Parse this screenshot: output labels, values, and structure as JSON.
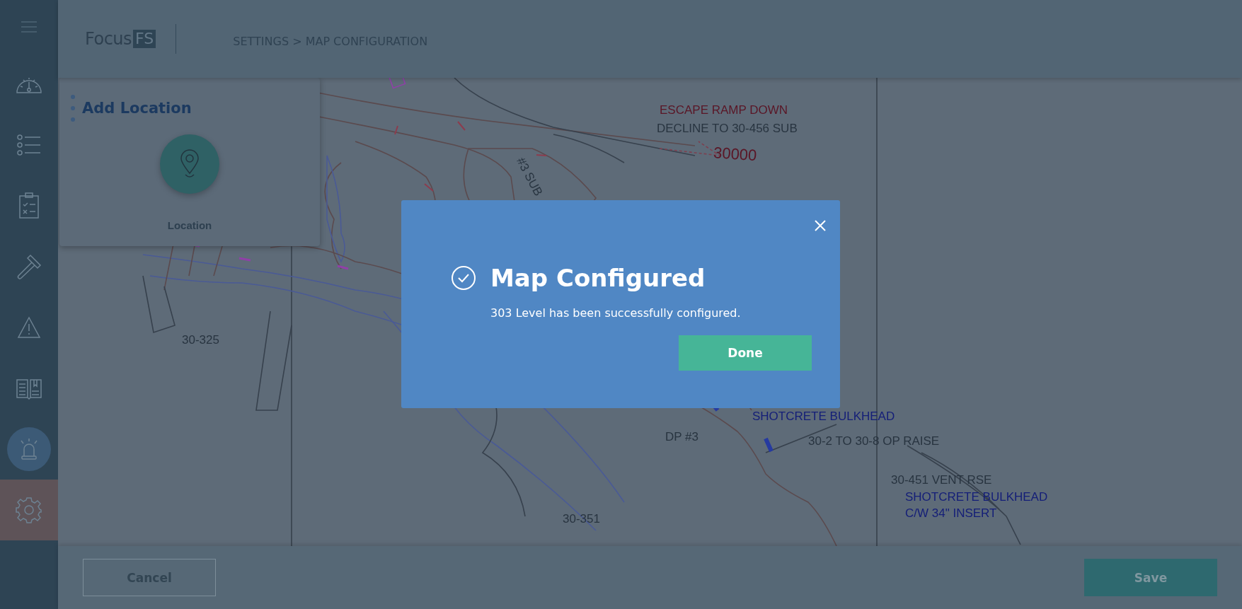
{
  "sidebar": {
    "items": [
      {
        "selected": false,
        "highlighted": false
      },
      {
        "selected": false,
        "highlighted": false
      },
      {
        "selected": false,
        "highlighted": false
      },
      {
        "selected": false,
        "highlighted": false
      },
      {
        "selected": false,
        "highlighted": false
      },
      {
        "selected": false,
        "highlighted": false
      },
      {
        "selected": false,
        "highlighted": true
      },
      {
        "selected": true,
        "highlighted": false
      }
    ]
  },
  "header": {
    "logo": {
      "text": "Focus",
      "badge": "FS"
    },
    "breadcrumb": "SETTINGS > MAP CONFIGURATION"
  },
  "add_location_panel": {
    "title": "Add Location",
    "location_button": {
      "label": "Location"
    }
  },
  "map": {
    "labels": [
      {
        "text": "ESCAPE RAMP DOWN",
        "color": "#5a1626"
      },
      {
        "text": "DECLINE TO 30-456 SUB",
        "color": "#283440"
      },
      {
        "text": "30000",
        "color": "#5a1626"
      },
      {
        "text": "#3 SUB",
        "color": "#283440"
      },
      {
        "text": "30-325",
        "color": "#283440"
      },
      {
        "text": "SHOTCRETE BULKHEAD",
        "color": "#141e78"
      },
      {
        "text": "DP #3",
        "color": "#283440"
      },
      {
        "text": "30-2 TO 30-8 OP RAISE",
        "color": "#283440"
      },
      {
        "text": "30-451 VENT RSE",
        "color": "#283440"
      },
      {
        "text": "SHOTCRETE BULKHEAD",
        "color": "#141e78"
      },
      {
        "text": "C/W 34\" INSERT",
        "color": "#141e78"
      },
      {
        "text": "30-351",
        "color": "#283440"
      }
    ]
  },
  "dialog": {
    "title": "Map Configured",
    "message": "303 Level has been successfully configured.",
    "done_button": "Done"
  },
  "footer": {
    "cancel_button": "Cancel",
    "save_button": "Save"
  }
}
